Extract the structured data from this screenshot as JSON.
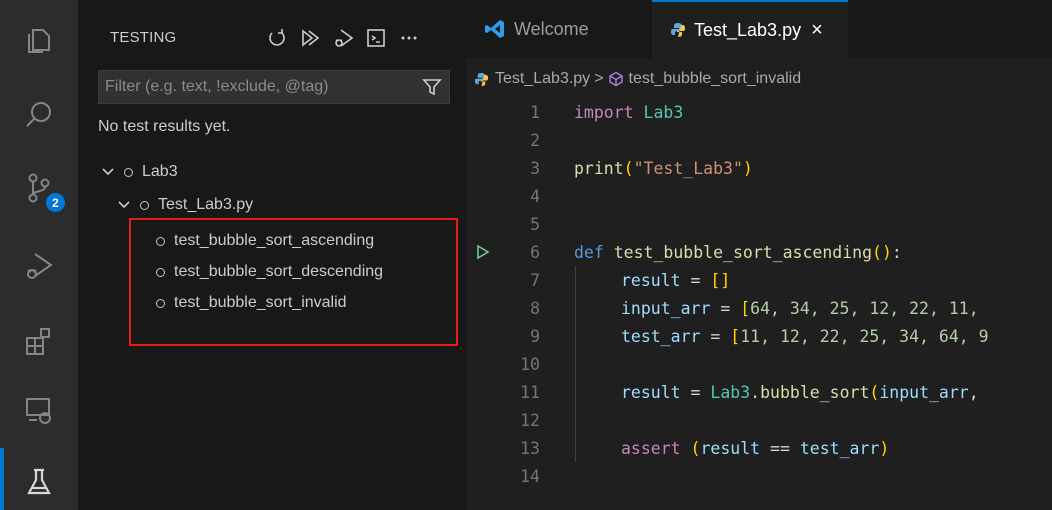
{
  "activity_bar": {
    "items": [
      "explorer-icon",
      "search-icon",
      "source-control-icon",
      "run-debug-icon",
      "extensions-icon",
      "remote-explorer-icon",
      "testing-icon"
    ],
    "source_control_badge": "2"
  },
  "sidebar": {
    "title": "TESTING",
    "actions": [
      "refresh-icon",
      "run-all-icon",
      "debug-all-icon",
      "terminal-icon",
      "more-icon"
    ],
    "filter_placeholder": "Filter (e.g. text, !exclude, @tag)",
    "empty_message": "No test results yet.",
    "tree": {
      "root": "Lab3",
      "file": "Test_Lab3.py",
      "tests": [
        "test_bubble_sort_ascending",
        "test_bubble_sort_descending",
        "test_bubble_sort_invalid"
      ]
    }
  },
  "editor": {
    "tabs": [
      {
        "label": "Welcome",
        "active": false
      },
      {
        "label": "Test_Lab3.py",
        "active": true,
        "close": "×"
      }
    ],
    "breadcrumb": {
      "file": "Test_Lab3.py",
      "separator": ">",
      "symbol": "test_bubble_sort_invalid"
    },
    "line_numbers": [
      "1",
      "2",
      "3",
      "4",
      "5",
      "6",
      "7",
      "8",
      "9",
      "10",
      "11",
      "12",
      "13",
      "14"
    ],
    "code": {
      "l1_kw": "import",
      "l1_mod": " Lab3",
      "l3_fn": "print",
      "l3_open": "(",
      "l3_str": "\"Test_Lab3\"",
      "l3_close": ")",
      "l6_kw": "def",
      "l6_fn": " test_bubble_sort_ascending",
      "l6_parens": "()",
      "l6_colon": ":",
      "l7_var": "result",
      "l7_op": " = ",
      "l7_br": "[]",
      "l8_var": "input_arr",
      "l8_op": " = ",
      "l8_br": "[",
      "l8_vals": "64, 34, 25, 12, 22, 11,",
      "l9_var": "test_arr",
      "l9_op": " = ",
      "l9_br": "[",
      "l9_vals": "11, 12, 22, 25, 34, 64, 9",
      "l11_var": "result",
      "l11_op": " = ",
      "l11_mod": "Lab3",
      "l11_dot": ".",
      "l11_fn": "bubble_sort",
      "l11_open": "(",
      "l11_arg": "input_arr",
      "l11_comma": ",",
      "l13_kw": "assert",
      "l13_open": " (",
      "l13_var1": "result",
      "l13_op": " == ",
      "l13_var2": "test_arr",
      "l13_close": ")"
    }
  },
  "colors": {
    "accent": "#0078d4",
    "highlight_border": "#e51c1c",
    "run_icon": "#73c991"
  }
}
